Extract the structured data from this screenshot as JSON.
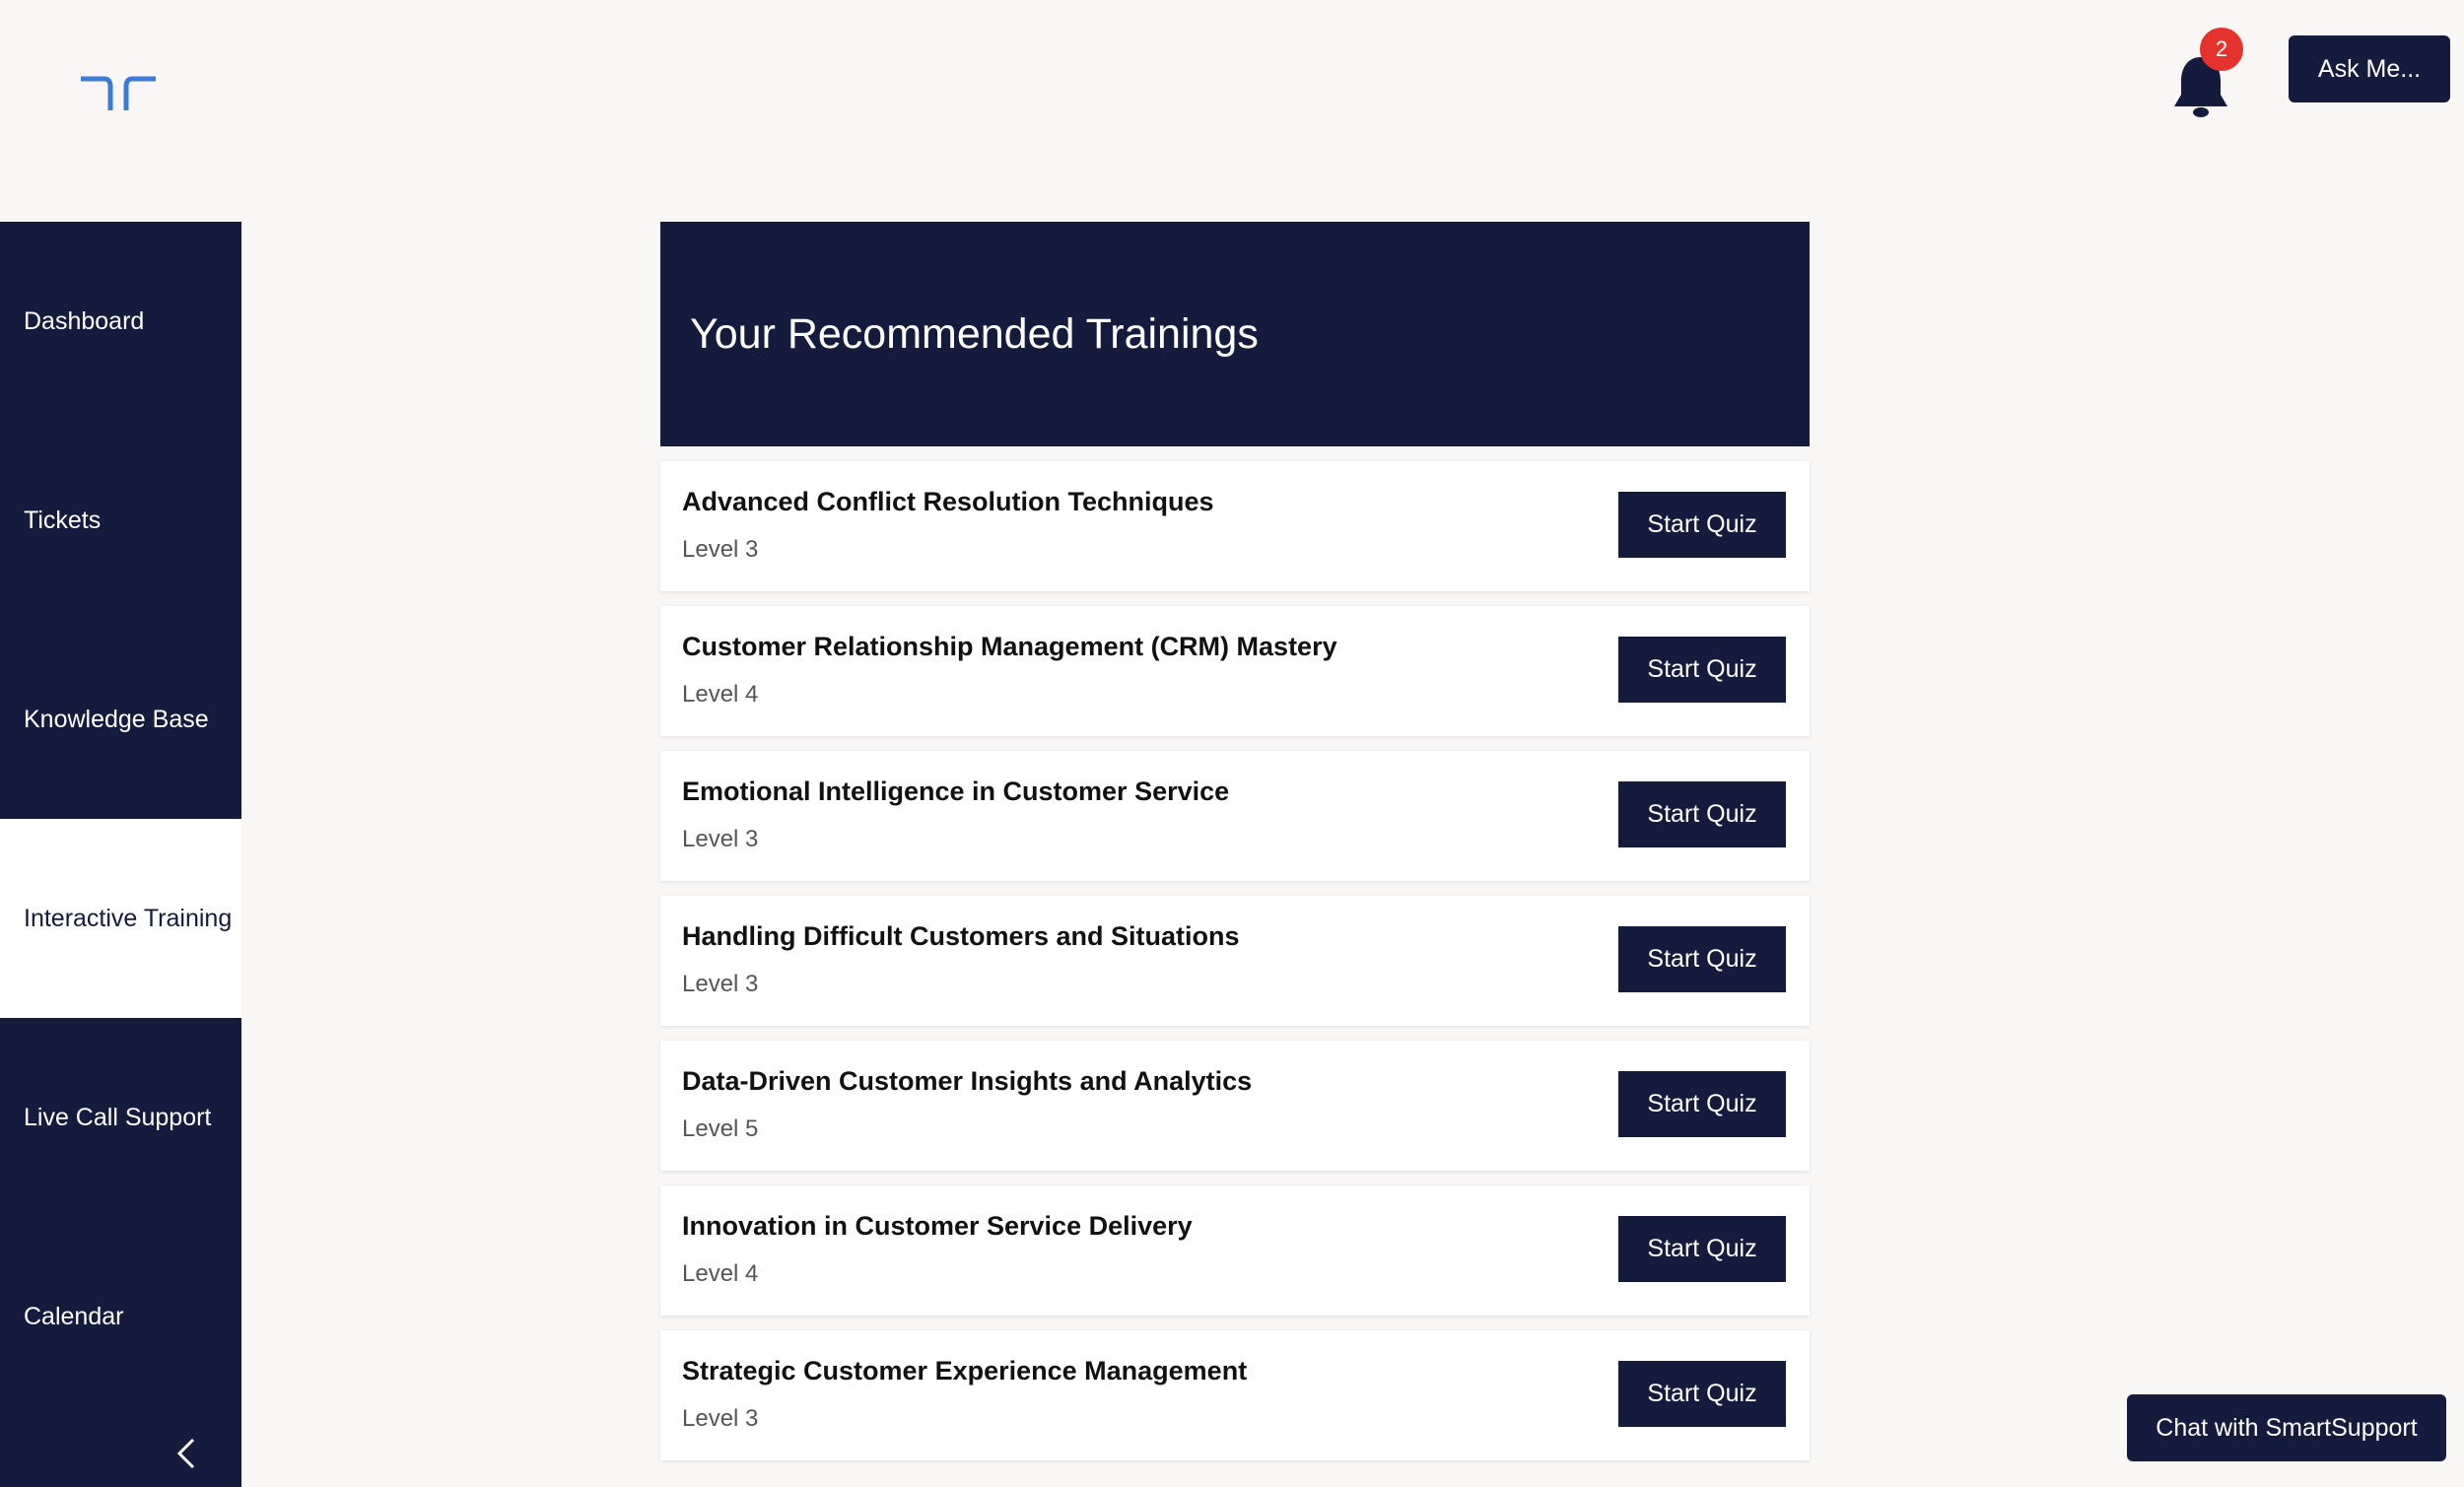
{
  "header": {
    "logo_icon": "brand-logo",
    "notifications": {
      "icon": "bell-icon",
      "count": "2"
    },
    "ask_label": "Ask Me..."
  },
  "sidebar": {
    "items": [
      {
        "label": "Dashboard",
        "active": false
      },
      {
        "label": "Tickets",
        "active": false
      },
      {
        "label": "Knowledge Base",
        "active": false
      },
      {
        "label": "Interactive Training",
        "active": true
      },
      {
        "label": "Live Call Support",
        "active": false
      },
      {
        "label": "Calendar",
        "active": false
      }
    ],
    "collapse_icon": "chevron-left-icon"
  },
  "main": {
    "title": "Your Recommended Trainings",
    "trainings": [
      {
        "title": "Advanced Conflict Resolution Techniques",
        "level": "Level 3",
        "button": "Start Quiz"
      },
      {
        "title": "Customer Relationship Management (CRM) Mastery",
        "level": "Level 4",
        "button": "Start Quiz"
      },
      {
        "title": "Emotional Intelligence in Customer Service",
        "level": "Level 3",
        "button": "Start Quiz"
      },
      {
        "title": "Handling Difficult Customers and Situations",
        "level": "Level 3",
        "button": "Start Quiz"
      },
      {
        "title": "Data-Driven Customer Insights and Analytics",
        "level": "Level 5",
        "button": "Start Quiz"
      },
      {
        "title": "Innovation in Customer Service Delivery",
        "level": "Level 4",
        "button": "Start Quiz"
      },
      {
        "title": "Strategic Customer Experience Management",
        "level": "Level 3",
        "button": "Start Quiz"
      }
    ]
  },
  "chat": {
    "label": "Chat with SmartSupport"
  },
  "colors": {
    "primary": "#141b3c",
    "background": "#f9f7f6",
    "logo": "#3a7bd5",
    "badge": "#e5322d"
  }
}
